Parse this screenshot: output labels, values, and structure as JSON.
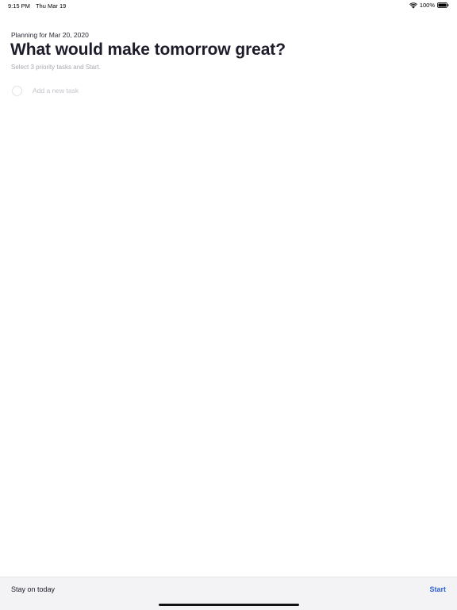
{
  "status_bar": {
    "time": "9:15 PM",
    "date": "Thu Mar 19",
    "battery": "100%",
    "icons": [
      "wifi-icon",
      "battery-icon"
    ]
  },
  "header": {
    "planning_label": "Planning for Mar 20, 2020",
    "title": "What would make tomorrow great?",
    "subtitle": "Select 3 priority tasks and Start."
  },
  "task_input": {
    "placeholder": "Add a new task",
    "value": ""
  },
  "bottom_bar": {
    "stay_label": "Stay on today",
    "start_label": "Start"
  },
  "colors": {
    "accent": "#2f63d8",
    "title": "#1c1c2b",
    "muted": "#a9a9b2",
    "bottom_bar_bg": "#f3f3f5"
  }
}
